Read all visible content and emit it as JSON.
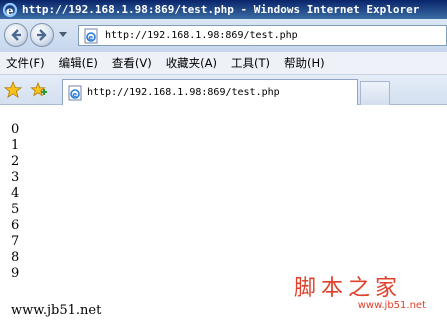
{
  "window": {
    "title": "http://192.168.1.98:869/test.php - Windows Internet Explorer"
  },
  "address_bar": {
    "url": "http://192.168.1.98:869/test.php"
  },
  "menu": {
    "items": [
      "文件(F)",
      "编辑(E)",
      "查看(V)",
      "收藏夹(A)",
      "工具(T)",
      "帮助(H)"
    ]
  },
  "tab": {
    "label": "http://192.168.1.98:869/test.php"
  },
  "content": {
    "lines": [
      "0",
      "1",
      "2",
      "3",
      "4",
      "5",
      "6",
      "7",
      "8",
      "9"
    ],
    "site_text": "www.jb51.net"
  },
  "watermark": {
    "name": "脚本之家",
    "url": "www.jb51.net"
  },
  "icons": {
    "title": "ie-logo-icon",
    "back": "back-arrow-icon",
    "forward": "forward-arrow-icon",
    "page": "ie-page-icon",
    "favorites": "favorites-star-icon",
    "add_favorites": "add-favorites-icon"
  },
  "colors": {
    "titlebar": "#0a246a",
    "watermark": "#e0412a"
  }
}
